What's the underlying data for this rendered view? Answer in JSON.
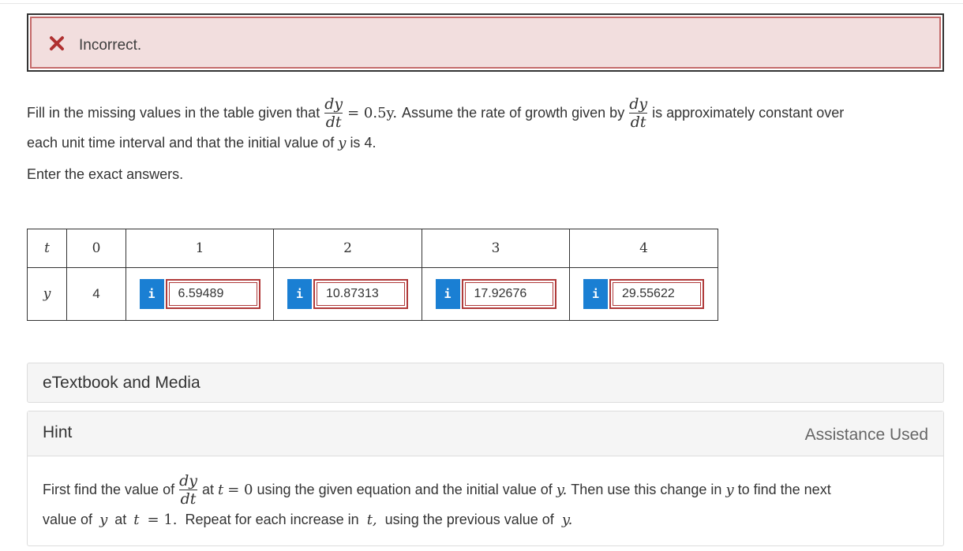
{
  "feedback": {
    "status_text": "Incorrect."
  },
  "question": {
    "p1_before": "Fill in the missing values in the table given that",
    "frac_num": "dy",
    "frac_den": "dt",
    "eq_rhs": "= 0.5y.",
    "p1_mid": "Assume the rate of growth given by",
    "p1_after": "is approximately constant over",
    "p2_a": "each unit time interval and that the initial value of",
    "p2_var": "y",
    "p2_b": "is 4.",
    "instruction": "Enter the exact answers."
  },
  "table": {
    "row_t": {
      "label": "t",
      "values": [
        "0",
        "1",
        "2",
        "3",
        "4"
      ]
    },
    "row_y": {
      "label": "y",
      "initial": "4",
      "info_glyph": "i",
      "answers": [
        "6.59489",
        "10.87313",
        "17.92676",
        "29.55622"
      ]
    }
  },
  "panels": {
    "etextbook": "eTextbook and Media",
    "hint_title": "Hint",
    "assistance": "Assistance Used"
  },
  "hint": {
    "l1_a": "First find the value of",
    "l1_num": "dy",
    "l1_den": "dt",
    "l1_at": "at",
    "l1_t": "t",
    "l1_eq": "= 0",
    "l1_b": "using the given equation and the initial value of",
    "l1_y": "y.",
    "l1_c": "Then use this change in",
    "l1_y2": "y",
    "l1_d": "to find the next",
    "l2_a": "value of",
    "l2_y": "y",
    "l2_at": "at",
    "l2_t": "t",
    "l2_eq": "= 1.",
    "l2_b": "Repeat for each increase in",
    "l2_t2": "t,",
    "l2_c": "using the previous value of",
    "l2_y2": "y."
  },
  "colors": {
    "error_bg": "#f2dede",
    "error_border": "#c46a6a",
    "info_blue": "#1a7fd3",
    "answer_border": "#b03a3a",
    "x_red": "#b03030"
  },
  "icons": {
    "status": "x-icon",
    "info": "info-icon"
  }
}
